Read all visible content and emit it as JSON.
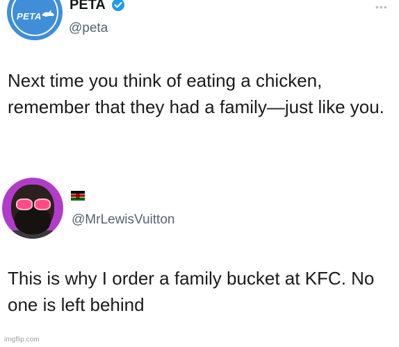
{
  "tweets": [
    {
      "author": {
        "display_name": "PETA",
        "verified": true,
        "handle": "@peta",
        "avatar_icon": "peta-logo-avatar",
        "avatar_logo_text": "PETA"
      },
      "more_icon": "ellipsis-icon",
      "text": "Next time you think of eating a chicken, remember that they had a family—just like you."
    },
    {
      "author": {
        "display_name_icon": "kenya-flag-icon",
        "handle": "@MrLewisVuitton",
        "avatar_icon": "user-photo-avatar"
      },
      "text": "This is why I order a family bucket at KFC. No one is left behind"
    }
  ],
  "watermark": "imgflip.com",
  "colors": {
    "peta_avatar": "#3f8fd8",
    "verified_badge": "#1d9bf0",
    "user_avatar_bg": "#b23cc9",
    "handle_text": "#536471"
  }
}
